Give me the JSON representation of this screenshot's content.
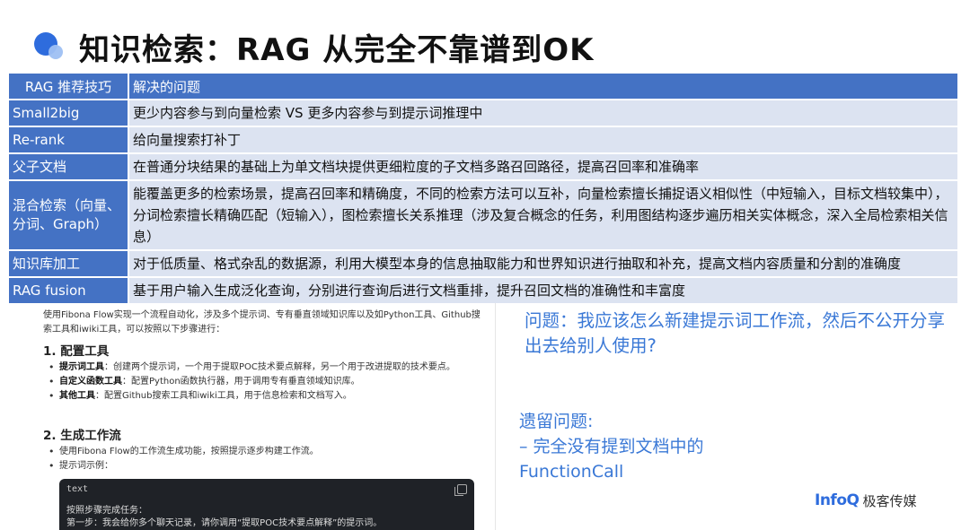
{
  "title": "知识检索：RAG 从完全不靠谱到OK",
  "table": {
    "headers": [
      "RAG 推荐技巧",
      "解决的问题"
    ],
    "rows": [
      {
        "key": "Small2big",
        "value": "更少内容参与到向量检索 VS 更多内容参与到提示词推理中"
      },
      {
        "key": "Re-rank",
        "value": "给向量搜索打补丁"
      },
      {
        "key": "父子文档",
        "value": "在普通分块结果的基础上为单文档块提供更细粒度的子文档多路召回路径，提高召回率和准确率"
      },
      {
        "key": "混合检索（向量、分词、Graph）",
        "value": "能覆盖更多的检索场景，提高召回率和精确度，不同的检索方法可以互补，向量检索擅长捕捉语义相似性（中短输入，目标文档较集中），分词检索擅长精确匹配（短输入），图检索擅长关系推理（涉及复合概念的任务，利用图结构逐步遍历相关实体概念，深入全局检索相关信息）"
      },
      {
        "key": "知识库加工",
        "value": "对于低质量、格式杂乱的数据源，利用大模型本身的信息抽取能力和世界知识进行抽取和补充，提高文档内容质量和分割的准确度"
      },
      {
        "key": "RAG fusion",
        "value": "基于用户输入生成泛化查询，分别进行查询后进行文档重排，提升召回文档的准确性和丰富度"
      }
    ]
  },
  "screenshot": {
    "intro": "使用Fibona Flow实现一个流程自动化，涉及多个提示词、专有垂直领域知识库以及如Python工具、Github搜索工具和iwiki工具，可以按照以下步骤进行：",
    "section1": "1. 配置工具",
    "s1_items": [
      {
        "bold": "提示词工具",
        "text": "：创建两个提示词，一个用于提取POC技术要点解释，另一个用于改进提取的技术要点。"
      },
      {
        "bold": "自定义函数工具",
        "text": "：配置Python函数执行器，用于调用专有垂直领域知识库。"
      },
      {
        "bold": "其他工具",
        "text": "：配置Github搜索工具和iwiki工具，用于信息检索和文档写入。"
      }
    ],
    "section2": "2. 生成工作流",
    "s2_items": [
      "使用Fibona Flow的工作流生成功能，按照提示逐步构建工作流。",
      "提示词示例："
    ],
    "code_lang": "text",
    "code_line1": "按照步骤完成任务：",
    "code_line2": "第一步：我会给你多个聊天记录，请你调用“提取POC技术要点解释”的提示词。"
  },
  "question": "问题：我应该怎么新建提示词工作流，然后不公开分享出去给别人使用?",
  "leftover": {
    "title": "遗留问题:",
    "line1": "– 完全没有提到文档中的",
    "line2": "FunctionCall"
  },
  "logo": {
    "brand": "InfoQ",
    "cn": "极客传媒"
  },
  "colors": {
    "header_blue": "#4472c4",
    "cell_bg": "#dce3f1",
    "question_blue": "#3a78d6"
  }
}
